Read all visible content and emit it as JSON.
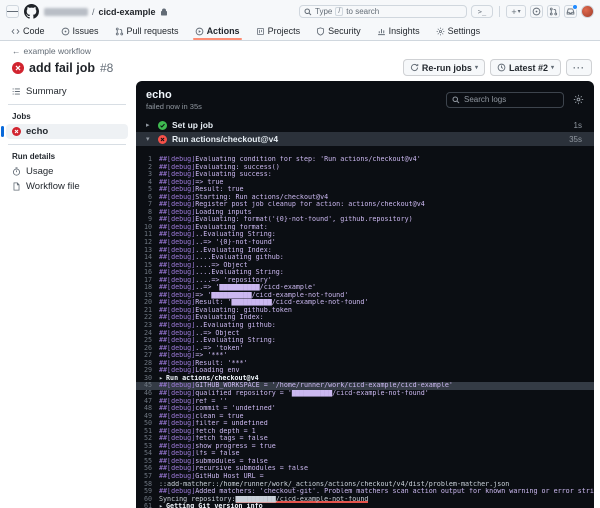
{
  "header": {
    "repo": "cicd-example",
    "separator": "/",
    "search_placeholder": "Type / to search",
    "search_key_hint": "/",
    "command_glyph": ">_",
    "plus_glyph": "+"
  },
  "nav": {
    "tabs": [
      {
        "label": "Code",
        "icon": "code",
        "active": false
      },
      {
        "label": "Issues",
        "icon": "issue",
        "active": false
      },
      {
        "label": "Pull requests",
        "icon": "pr",
        "active": false
      },
      {
        "label": "Actions",
        "icon": "actions",
        "active": true
      },
      {
        "label": "Projects",
        "icon": "projects",
        "active": false
      },
      {
        "label": "Security",
        "icon": "security",
        "active": false
      },
      {
        "label": "Insights",
        "icon": "insights",
        "active": false
      },
      {
        "label": "Settings",
        "icon": "settings",
        "active": false
      }
    ]
  },
  "run": {
    "back_label": "example workflow",
    "back_arrow": "←",
    "title": "add fail job",
    "number": "#8",
    "status": "failure",
    "rerun_button": "Re-run jobs",
    "latest_button": "Latest #2",
    "kebab_glyph": "···",
    "caret_glyph": "▾"
  },
  "sidebar": {
    "summary_label": "Summary",
    "jobs_section": "Jobs",
    "jobs": [
      {
        "name": "echo",
        "status": "failure",
        "selected": true
      }
    ],
    "details_section": "Run details",
    "usage_label": "Usage",
    "workflow_file_label": "Workflow file"
  },
  "colors": {
    "accent_blue": "#0969da",
    "fail_red_light": "#d1242f",
    "fail_red_dark": "#f85149",
    "success_green": "#3fb950",
    "nav_active_underline": "#fd8c73",
    "debug_purple": "#9e7bdb",
    "annotation_red": "#e5534b"
  },
  "log": {
    "job_name": "echo",
    "status_line": "failed now in 35s",
    "search_placeholder": "Search logs",
    "debug_prefix": "##[debug]",
    "collapsed_chevron": "▸",
    "expanded_chevron": "▾",
    "steps": [
      {
        "label": "Set up job",
        "duration": "1s",
        "status": "success",
        "expanded": false
      },
      {
        "label": "Run actions/checkout@v4",
        "duration": "35s",
        "status": "failure",
        "expanded": true
      }
    ],
    "lines": [
      {
        "n": 1,
        "t": "Evaluating condition for step: 'Run actions/checkout@v4'"
      },
      {
        "n": 2,
        "t": "Evaluating: success()"
      },
      {
        "n": 3,
        "t": "Evaluating success:"
      },
      {
        "n": 4,
        "t": "=> true"
      },
      {
        "n": 5,
        "t": "Result: true"
      },
      {
        "n": 6,
        "t": "Starting: Run actions/checkout@v4"
      },
      {
        "n": 7,
        "t": "Register post job cleanup for action: actions/checkout@v4"
      },
      {
        "n": 8,
        "t": "Loading inputs"
      },
      {
        "n": 9,
        "t": "Evaluating: format('{0}-not-found', github.repository)"
      },
      {
        "n": 10,
        "t": "Evaluating format:"
      },
      {
        "n": 11,
        "t": "..Evaluating String:"
      },
      {
        "n": 12,
        "t": "..=> '{0}-not-found'"
      },
      {
        "n": 13,
        "t": "..Evaluating Index:"
      },
      {
        "n": 14,
        "t": "....Evaluating github:"
      },
      {
        "n": 15,
        "t": "....=> Object"
      },
      {
        "n": 16,
        "t": "....Evaluating String:"
      },
      {
        "n": 17,
        "t": "....=> 'repository'"
      },
      {
        "n": 18,
        "t": "..=> '██████████/cicd-example'"
      },
      {
        "n": 19,
        "t": "=> '██████████/cicd-example-not-found'"
      },
      {
        "n": 20,
        "t": "Result: '██████████/cicd-example-not-found'"
      },
      {
        "n": 21,
        "t": "Evaluating: github.token"
      },
      {
        "n": 22,
        "t": "Evaluating Index:"
      },
      {
        "n": 23,
        "t": "..Evaluating github:"
      },
      {
        "n": 24,
        "t": "..=> Object"
      },
      {
        "n": 25,
        "t": "..Evaluating String:"
      },
      {
        "n": 26,
        "t": "..=> 'token'"
      },
      {
        "n": 27,
        "t": "=> '***'"
      },
      {
        "n": 28,
        "t": "Result: '***'"
      },
      {
        "n": 29,
        "t": "Loading env"
      },
      {
        "n": 30,
        "kind": "group",
        "t": "Run actions/checkout@v4"
      },
      {
        "n": 45,
        "t": "GITHUB_WORKSPACE = '/home/runner/work/cicd-example/cicd-example'",
        "hl": true
      },
      {
        "n": 46,
        "t": "qualified repository = '██████████/cicd-example-not-found'"
      },
      {
        "n": 47,
        "t": "ref = ''"
      },
      {
        "n": 48,
        "t": "commit = 'undefined'"
      },
      {
        "n": 49,
        "t": "clean = true"
      },
      {
        "n": 50,
        "t": "filter = undefined"
      },
      {
        "n": 51,
        "t": "fetch depth = 1"
      },
      {
        "n": 52,
        "t": "fetch tags = false"
      },
      {
        "n": 53,
        "t": "show progress = true"
      },
      {
        "n": 54,
        "t": "lfs = false"
      },
      {
        "n": 55,
        "t": "submodules = false"
      },
      {
        "n": 56,
        "t": "recursive submodules = false"
      },
      {
        "n": 57,
        "t": "GitHub Host URL = "
      },
      {
        "n": 58,
        "kind": "plain",
        "t": "::add-matcher::/home/runner/work/_actions/actions/checkout/v4/dist/problem-matcher.json"
      },
      {
        "n": 59,
        "t": "Added matchers: 'checkout-git'. Problem matchers scan action output for known warning or error strings and report these inline."
      },
      {
        "n": 60,
        "kind": "plain",
        "t": "Syncing repository: ",
        "t2": "██████████/cicd-example-not-found",
        "underline": true
      },
      {
        "n": 61,
        "kind": "group",
        "t": "Getting Git version info",
        "partial": true
      }
    ]
  }
}
